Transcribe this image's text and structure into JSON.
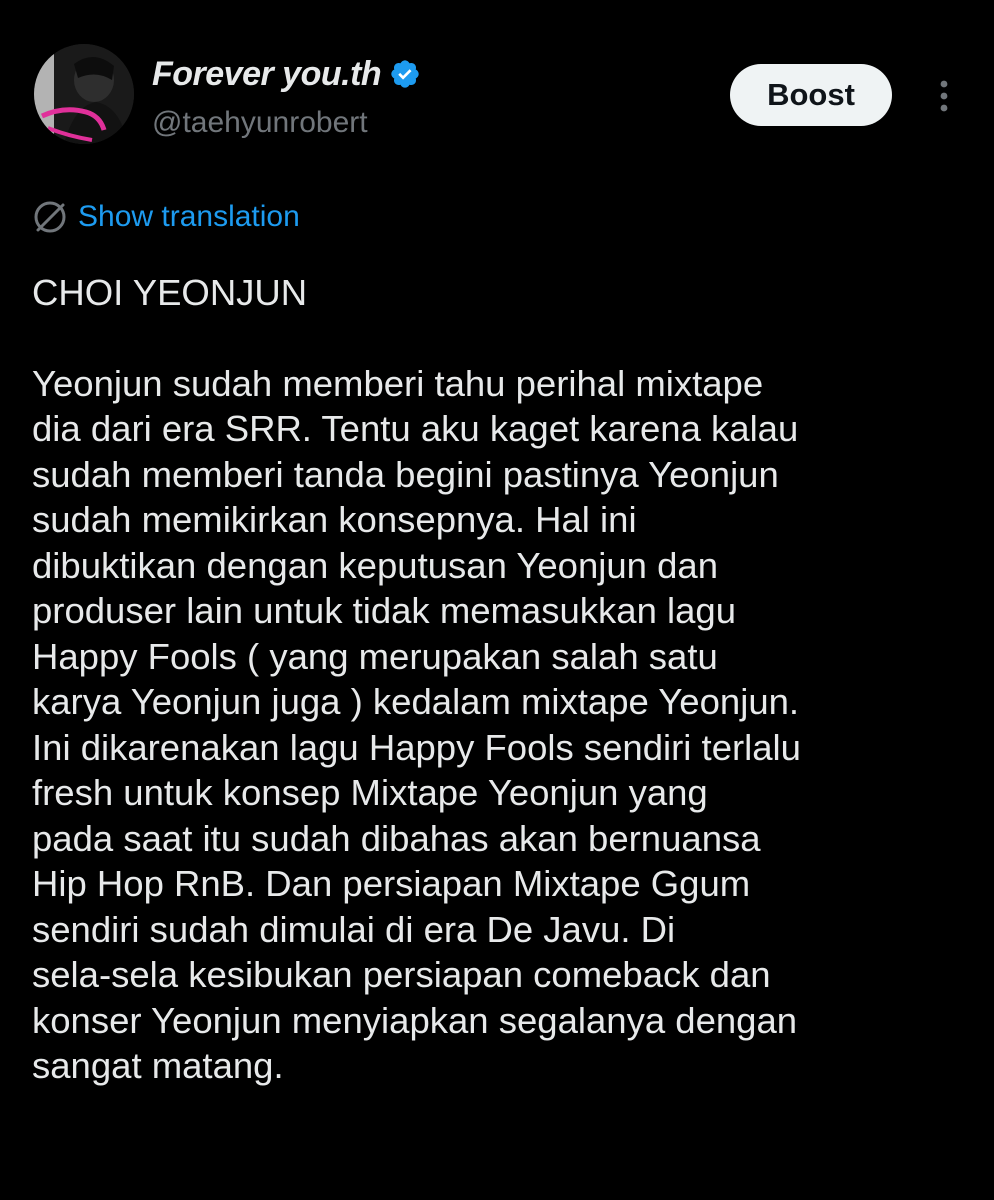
{
  "author": {
    "display_name": "Forever you.th",
    "handle": "@taehyunrobert",
    "verified": true
  },
  "actions": {
    "boost_label": "Boost",
    "more_icon": "more-vertical-icon"
  },
  "translation": {
    "icon": "globe-icon",
    "label": "Show translation"
  },
  "tweet": {
    "title": "CHOI YEONJUN",
    "lines": [
      "Yeonjun sudah memberi tahu perihal mixtape",
      "dia dari era SRR. Tentu aku kaget karena kalau",
      "sudah memberi tanda begini pastinya Yeonjun",
      "sudah memikirkan konsepnya. Hal ini",
      "dibuktikan dengan keputusan Yeonjun dan",
      "produser lain untuk tidak memasukkan lagu",
      "Happy Fools ( yang merupakan salah satu",
      "karya Yeonjun juga ) kedalam mixtape Yeonjun.",
      "Ini dikarenakan lagu Happy Fools sendiri terlalu",
      "fresh untuk konsep Mixtape Yeonjun yang",
      "pada saat itu sudah dibahas akan bernuansa",
      "Hip Hop RnB. Dan persiapan Mixtape Ggum",
      "sendiri sudah dimulai di era De Javu. Di",
      "sela-sela kesibukan persiapan comeback dan",
      "konser Yeonjun menyiapkan segalanya dengan",
      "sangat matang."
    ]
  },
  "colors": {
    "background": "#000000",
    "text": "#e7e9ea",
    "muted": "#71767b",
    "link": "#1d9bf0",
    "button_bg": "#eff3f4",
    "avatar_accent": "#e0309a"
  }
}
